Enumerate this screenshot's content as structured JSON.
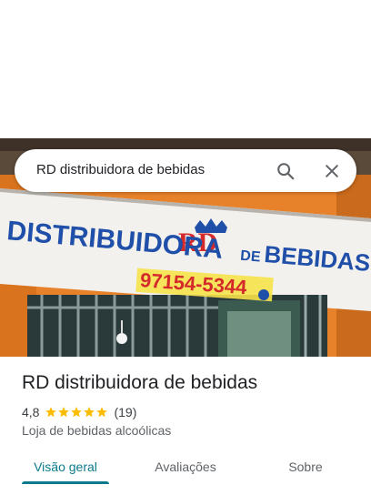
{
  "search": {
    "query": "RD distribuidora de bebidas"
  },
  "photo": {
    "sign_brand": "RD",
    "sign_headline_part1": "DISTRIBUIDORA",
    "sign_headline_part2": "BEBIDAS",
    "sign_headline_joiner": "DE",
    "sign_phone": "97154-5344"
  },
  "place": {
    "name": "RD distribuidora de bebidas",
    "rating": "4,8",
    "stars": 5,
    "reviews_count": "(19)",
    "category": "Loja de bebidas alcoólicas"
  },
  "tabs": [
    {
      "label": "Visão geral",
      "active": true
    },
    {
      "label": "Avaliações",
      "active": false
    },
    {
      "label": "Sobre",
      "active": false
    }
  ],
  "colors": {
    "accent": "#0b7a8a",
    "star": "#fbbc04",
    "sign_blue": "#1f4fa8",
    "sign_red": "#d42a2a"
  }
}
